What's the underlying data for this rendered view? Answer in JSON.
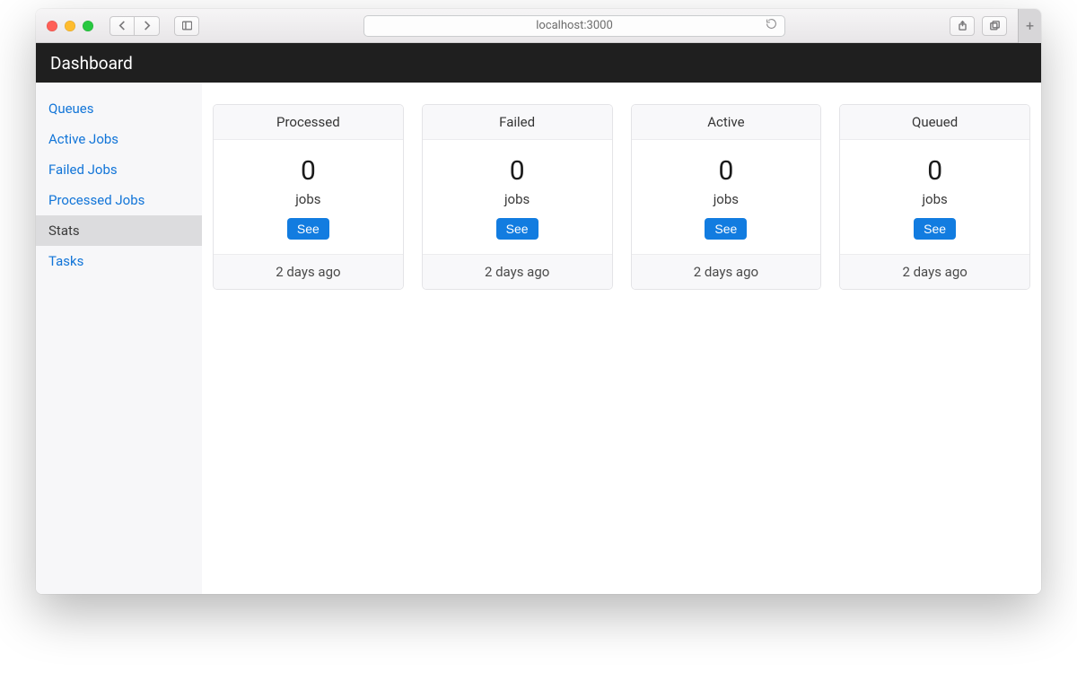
{
  "browser": {
    "address": "localhost:3000"
  },
  "navbar": {
    "title": "Dashboard"
  },
  "sidebar": {
    "items": [
      {
        "label": "Queues",
        "active": false
      },
      {
        "label": "Active Jobs",
        "active": false
      },
      {
        "label": "Failed Jobs",
        "active": false
      },
      {
        "label": "Processed Jobs",
        "active": false
      },
      {
        "label": "Stats",
        "active": true
      },
      {
        "label": "Tasks",
        "active": false
      }
    ]
  },
  "stats": {
    "jobs_label": "jobs",
    "see_label": "See",
    "cards": [
      {
        "title": "Processed",
        "count": "0",
        "ago": "2 days ago"
      },
      {
        "title": "Failed",
        "count": "0",
        "ago": "2 days ago"
      },
      {
        "title": "Active",
        "count": "0",
        "ago": "2 days ago"
      },
      {
        "title": "Queued",
        "count": "0",
        "ago": "2 days ago"
      }
    ]
  }
}
